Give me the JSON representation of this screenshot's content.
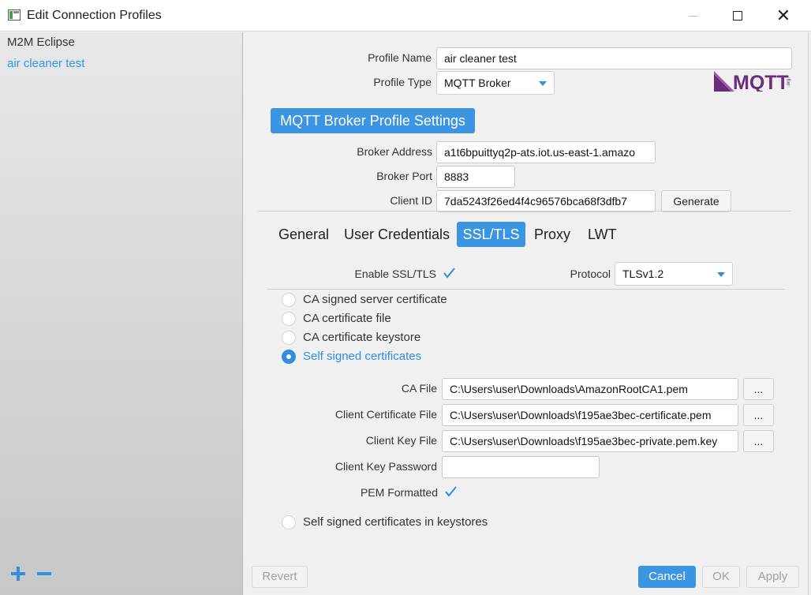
{
  "window": {
    "title": "Edit Connection Profiles",
    "close_glyph": "✕"
  },
  "sidebar": {
    "profiles": [
      {
        "label": "M2M Eclipse",
        "selected": false
      },
      {
        "label": "air cleaner test",
        "selected": true
      }
    ],
    "add_icon": "plus-icon",
    "remove_icon": "minus-icon"
  },
  "profile": {
    "name_label": "Profile Name",
    "name_value": "air cleaner test",
    "type_label": "Profile Type",
    "type_value": "MQTT Broker",
    "logo_text": "MQTT",
    "logo_sub": ".org"
  },
  "broker": {
    "section_title": "MQTT Broker Profile Settings",
    "address_label": "Broker Address",
    "address_value": "a1t6bpuittyq2p-ats.iot.us-east-1.amazo",
    "port_label": "Broker Port",
    "port_value": "8883",
    "client_id_label": "Client ID",
    "client_id_value": "7da5243f26ed4f4c96576bca68f3dfb7",
    "generate_label": "Generate"
  },
  "tabs": [
    {
      "label": "General",
      "active": false
    },
    {
      "label": "User Credentials",
      "active": false
    },
    {
      "label": "SSL/TLS",
      "active": true
    },
    {
      "label": "Proxy",
      "active": false
    },
    {
      "label": "LWT",
      "active": false
    }
  ],
  "ssl": {
    "enable_label": "Enable SSL/TLS",
    "enable_checked": true,
    "protocol_label": "Protocol",
    "protocol_value": "TLSv1.2",
    "options": [
      {
        "label": "CA signed server certificate",
        "selected": false
      },
      {
        "label": "CA certificate file",
        "selected": false
      },
      {
        "label": "CA certificate keystore",
        "selected": false
      },
      {
        "label": "Self signed certificates",
        "selected": true
      }
    ],
    "ca_file_label": "CA File",
    "ca_file_value": "C:\\Users\\user\\Downloads\\AmazonRootCA1.pem",
    "client_cert_label": "Client Certificate File",
    "client_cert_value": "C:\\Users\\user\\Downloads\\f195ae3bec-certificate.pem",
    "client_key_label": "Client Key File",
    "client_key_value": "C:\\Users\\user\\Downloads\\f195ae3bec-private.pem.key",
    "client_key_password_label": "Client Key Password",
    "client_key_password_value": "",
    "pem_label": "PEM Formatted",
    "pem_checked": true,
    "browse_label": "...",
    "keystore_option_label": "Self signed certificates in keystores",
    "keystore_option_selected": false
  },
  "footer": {
    "revert_label": "Revert",
    "cancel_label": "Cancel",
    "ok_label": "OK",
    "apply_label": "Apply"
  },
  "colors": {
    "accent": "#3c95e2",
    "selected_text": "#2f96e8",
    "mqtt_purple": "#6a2c7c"
  }
}
